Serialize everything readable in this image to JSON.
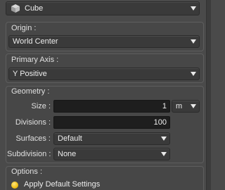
{
  "shape_select": {
    "value": "Cube",
    "icon": "cube-icon"
  },
  "origin": {
    "title": "Origin :",
    "value": "World Center"
  },
  "primary_axis": {
    "title": "Primary Axis :",
    "value": "Y Positive"
  },
  "geometry": {
    "title": "Geometry :",
    "size_label": "Size :",
    "size_value": "1",
    "size_unit": "m",
    "divisions_label": "Divisions :",
    "divisions_value": "100",
    "surfaces_label": "Surfaces :",
    "surfaces_value": "Default",
    "subdivision_label": "Subdivision :",
    "subdivision_value": "None"
  },
  "options": {
    "title": "Options :",
    "apply_default_label": "Apply Default Settings",
    "apply_default_selected": true
  },
  "colors": {
    "panel_bg": "#4a4a4a",
    "field_bg": "#1e1e1e",
    "radio_accent": "#f2c21b"
  }
}
